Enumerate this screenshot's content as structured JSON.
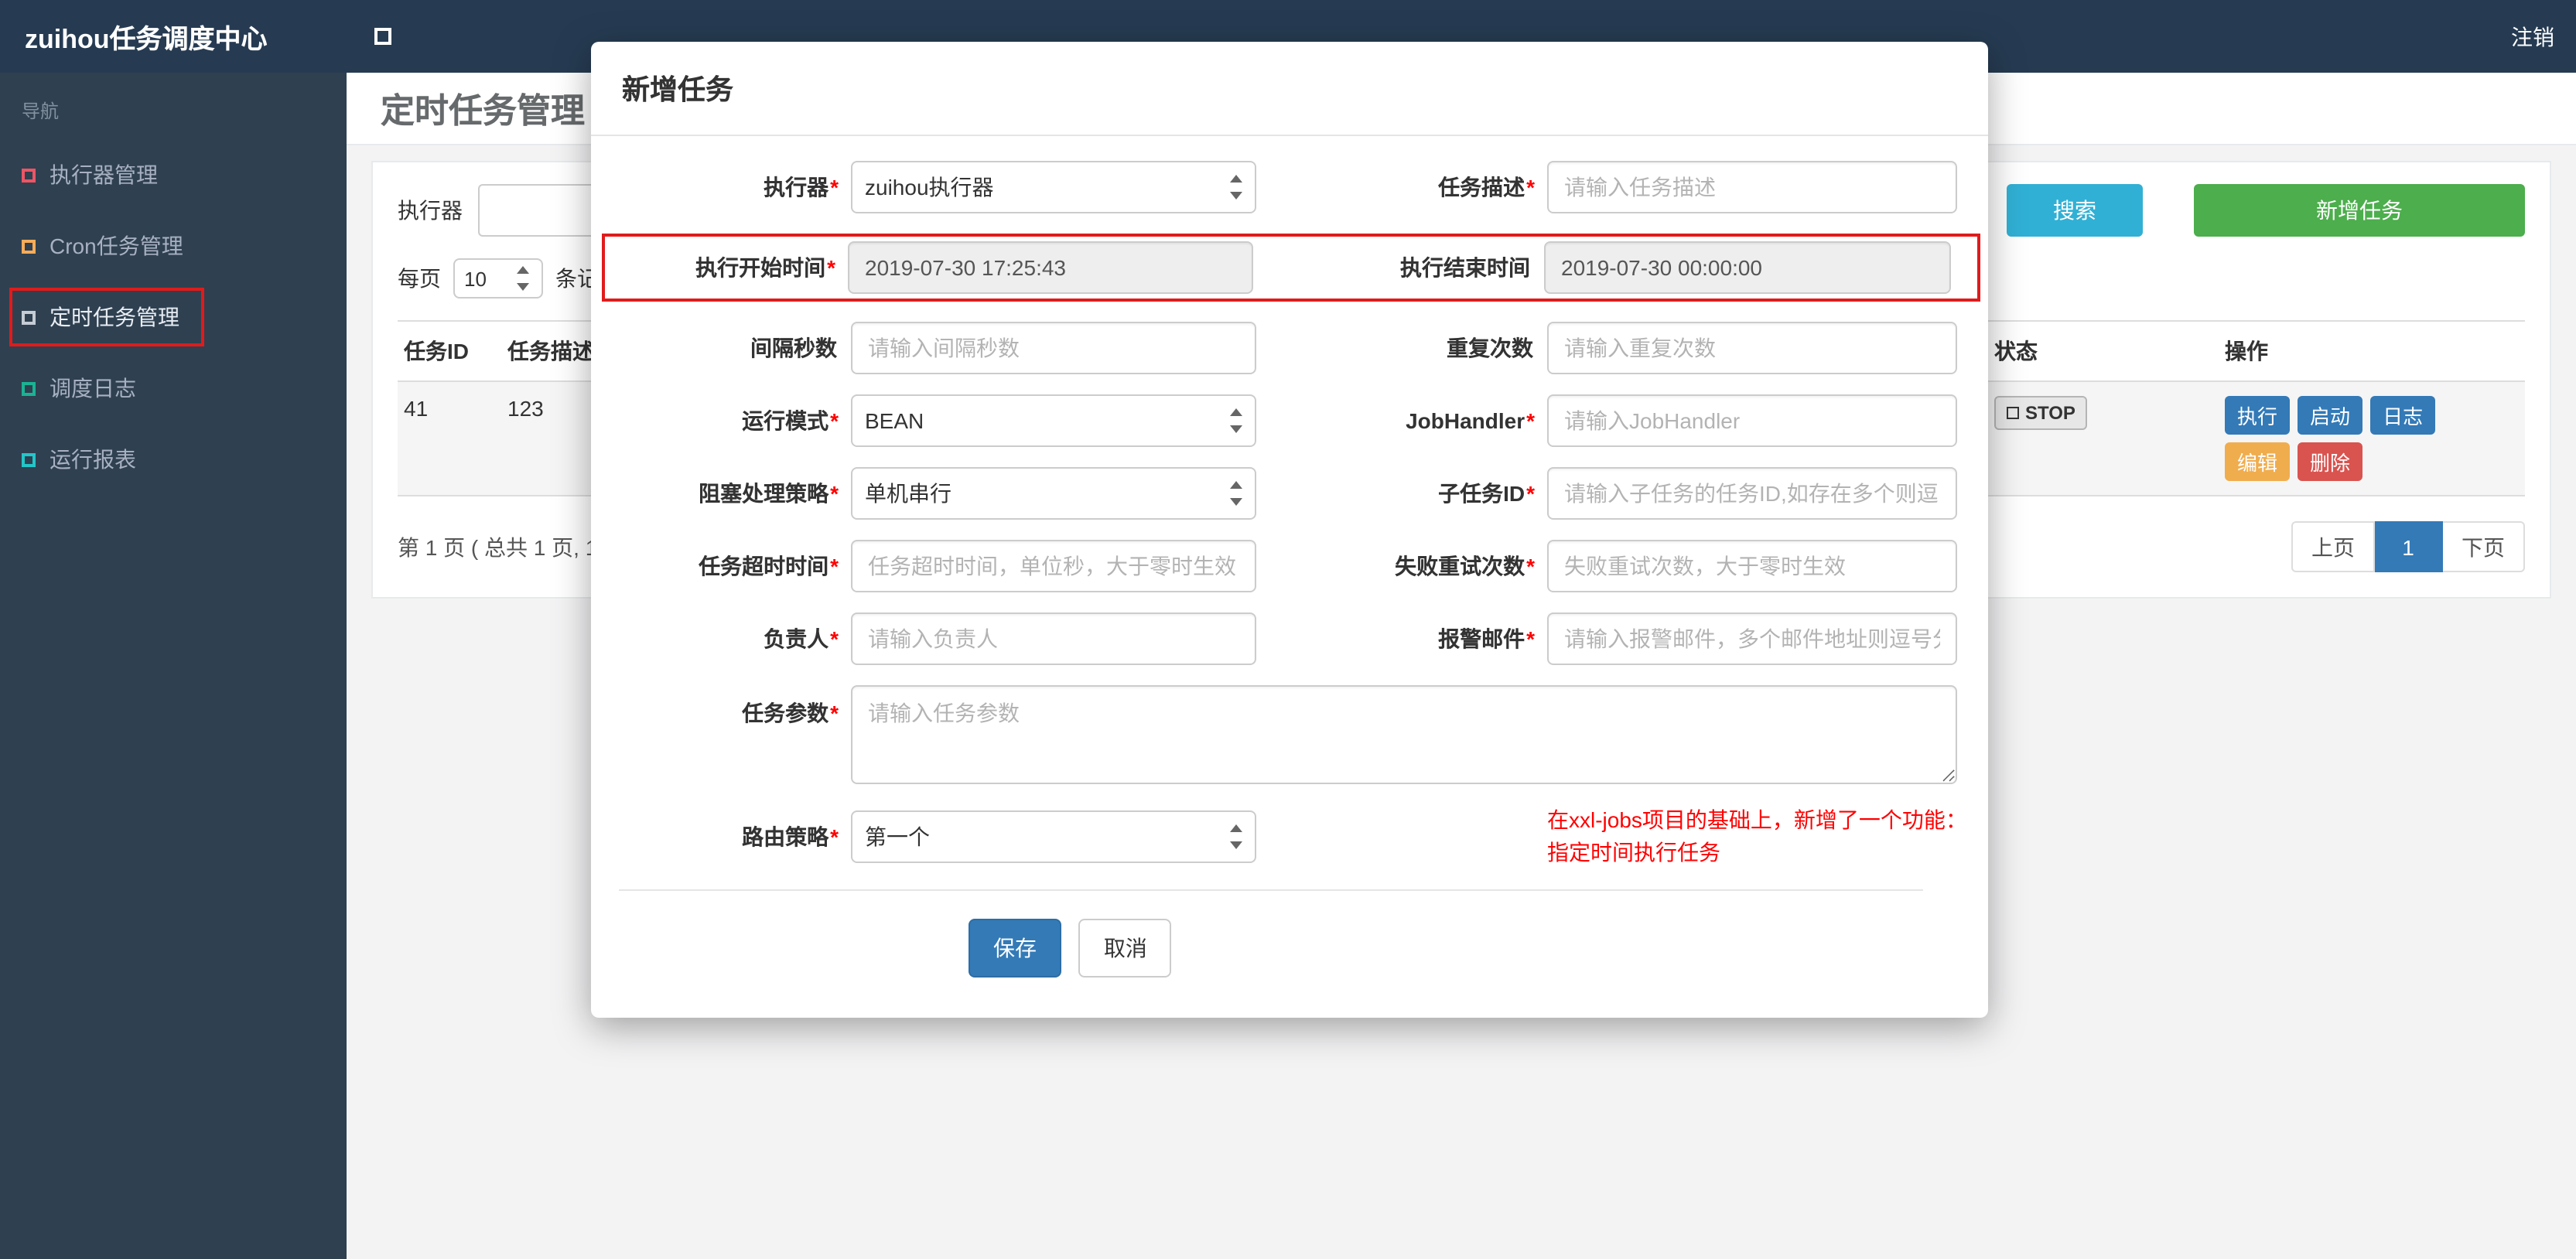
{
  "colors": {
    "topbar-bg": "#263b52",
    "sidebar-bg": "#2f4050",
    "content-bg": "#f3f3f4",
    "primary": "#337ab7",
    "search-btn": "#31b0d5",
    "add-btn": "#4cae4c",
    "warning": "#f0ad4e",
    "danger": "#d9534f",
    "annotation": "#e01b1b",
    "note-red": "#ff0000"
  },
  "topbar": {
    "brand": "zuihou任务调度中心",
    "logout": "注销"
  },
  "sidebar": {
    "nav_label": "导航",
    "items": [
      {
        "label": "执行器管理",
        "icon_color": "#ed5565"
      },
      {
        "label": "Cron任务管理",
        "icon_color": "#f8ac59"
      },
      {
        "label": "定时任务管理",
        "icon_color": "#c5ccd4"
      },
      {
        "label": "调度日志",
        "icon_color": "#1ab394"
      },
      {
        "label": "运行报表",
        "icon_color": "#23c6c8"
      }
    ]
  },
  "page": {
    "title": "定时任务管理",
    "toolbar": {
      "executor_label": "执行器",
      "search_button": "搜索",
      "add_button": "新增任务"
    },
    "per_page": {
      "prefix": "每页",
      "value": "10",
      "suffix": "条记"
    },
    "table": {
      "headers": {
        "id": "任务ID",
        "desc": "任务描述",
        "status": "状态",
        "actions": "操作"
      },
      "row": {
        "id": "41",
        "desc": "123",
        "status": "STOP",
        "btn_run": "执行",
        "btn_start": "启动",
        "btn_log": "日志",
        "btn_edit": "编辑",
        "btn_delete": "删除"
      }
    },
    "pagination": {
      "summary": "第 1 页 ( 总共 1 页, 1",
      "prev": "上页",
      "page": "1",
      "next": "下页"
    }
  },
  "modal": {
    "title": "新增任务",
    "fields": {
      "executor": {
        "label": "执行器",
        "star": "*",
        "value": "zuihou执行器"
      },
      "job_desc": {
        "label": "任务描述",
        "star": "*",
        "placeholder": "请输入任务描述"
      },
      "start_time": {
        "label": "执行开始时间",
        "star": "*",
        "value": "2019-07-30 17:25:43"
      },
      "end_time": {
        "label": "执行结束时间",
        "star": "",
        "value": "2019-07-30 00:00:00"
      },
      "interval": {
        "label": "间隔秒数",
        "star": "",
        "placeholder": "请输入间隔秒数"
      },
      "repeat_count": {
        "label": "重复次数",
        "star": "",
        "placeholder": "请输入重复次数"
      },
      "run_mode": {
        "label": "运行模式",
        "star": "*",
        "value": "BEAN"
      },
      "job_handler": {
        "label": "JobHandler",
        "star": "*",
        "placeholder": "请输入JobHandler"
      },
      "block_strategy": {
        "label": "阻塞处理策略",
        "star": "*",
        "value": "单机串行"
      },
      "child_job": {
        "label": "子任务ID",
        "star": "*",
        "placeholder": "请输入子任务的任务ID,如存在多个则逗"
      },
      "timeout": {
        "label": "任务超时时间",
        "star": "*",
        "placeholder": "任务超时时间，单位秒，大于零时生效"
      },
      "fail_retry": {
        "label": "失败重试次数",
        "star": "*",
        "placeholder": "失败重试次数，大于零时生效"
      },
      "owner": {
        "label": "负责人",
        "star": "*",
        "placeholder": "请输入负责人"
      },
      "alarm_email": {
        "label": "报警邮件",
        "star": "*",
        "placeholder": "请输入报警邮件，多个邮件地址则逗号分"
      },
      "job_param": {
        "label": "任务参数",
        "star": "*",
        "placeholder": "请输入任务参数"
      },
      "route_strategy": {
        "label": "路由策略",
        "star": "*",
        "value": "第一个"
      }
    },
    "note_line1": "在xxl-jobs项目的基础上，新增了一个功能：",
    "note_line2": "指定时间执行任务",
    "save_button": "保存",
    "cancel_button": "取消"
  }
}
